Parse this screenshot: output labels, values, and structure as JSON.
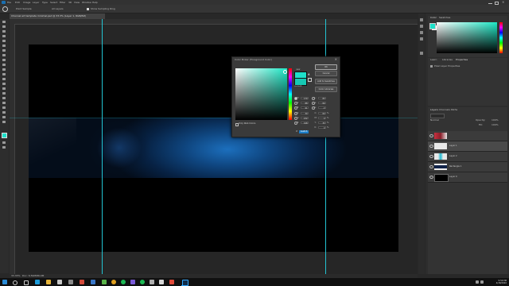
{
  "app": {
    "menu": [
      "File",
      "Edit",
      "Image",
      "Layer",
      "Type",
      "Select",
      "Filter",
      "3D",
      "View",
      "Window",
      "Help"
    ],
    "document_tab": "Channel art template minimal.psd @ 33.3% (Layer 1, RGB/8#)",
    "options": {
      "sample_size": "Point Sample",
      "sample": "All Layers",
      "show_ring": "Show Sampling Ring"
    },
    "status_zoom": "33.33%",
    "status_doc": "Doc: 6.59M/86.9M"
  },
  "color_picker": {
    "title": "Color Picker (Foreground Color)",
    "new_label": "new",
    "current_label": "current",
    "buttons": {
      "ok": "OK",
      "cancel": "Cancel",
      "add_swatches": "Add to Swatches",
      "libraries": "Color Libraries"
    },
    "fields": {
      "H": "170",
      "S": "88",
      "B": "91",
      "R": "30",
      "G": "232",
      "Bl": "198",
      "L": "83",
      "a": "-56",
      "b": "-3",
      "C": "60",
      "M": "0",
      "Y": "33",
      "K": "0"
    },
    "hex_label": "#",
    "hex": "1ee8c6",
    "web_only": "Only Web Colors",
    "new_color": "#1ee0c9",
    "current_color": "#17c8b4"
  },
  "panels": {
    "color_tabs": [
      "Color",
      "Swatches"
    ],
    "props_tabs": [
      "Learn",
      "Libraries",
      "Properties"
    ],
    "props_title": "Pixel Layer Properties",
    "layers_tabs": [
      "Layers",
      "Channels",
      "Paths"
    ],
    "blend_mode": "Normal",
    "opacity_label": "Opacity:",
    "opacity": "100%",
    "fill_label": "Fill:",
    "fill": "100%",
    "layers": [
      {
        "name": ""
      },
      {
        "name": "Layer 1"
      },
      {
        "name": "Layer 2"
      },
      {
        "name": "Rectangle 1"
      },
      {
        "name": "Layer 0"
      }
    ]
  },
  "taskbar": {
    "time": "9:59 PM",
    "date": "4/18/2020"
  },
  "colors": {
    "accent_teal": "#1ee8c6",
    "guide": "#23c3d2",
    "banner_blue": "#1c6fbd",
    "ps_blue": "#1c7dc8"
  }
}
